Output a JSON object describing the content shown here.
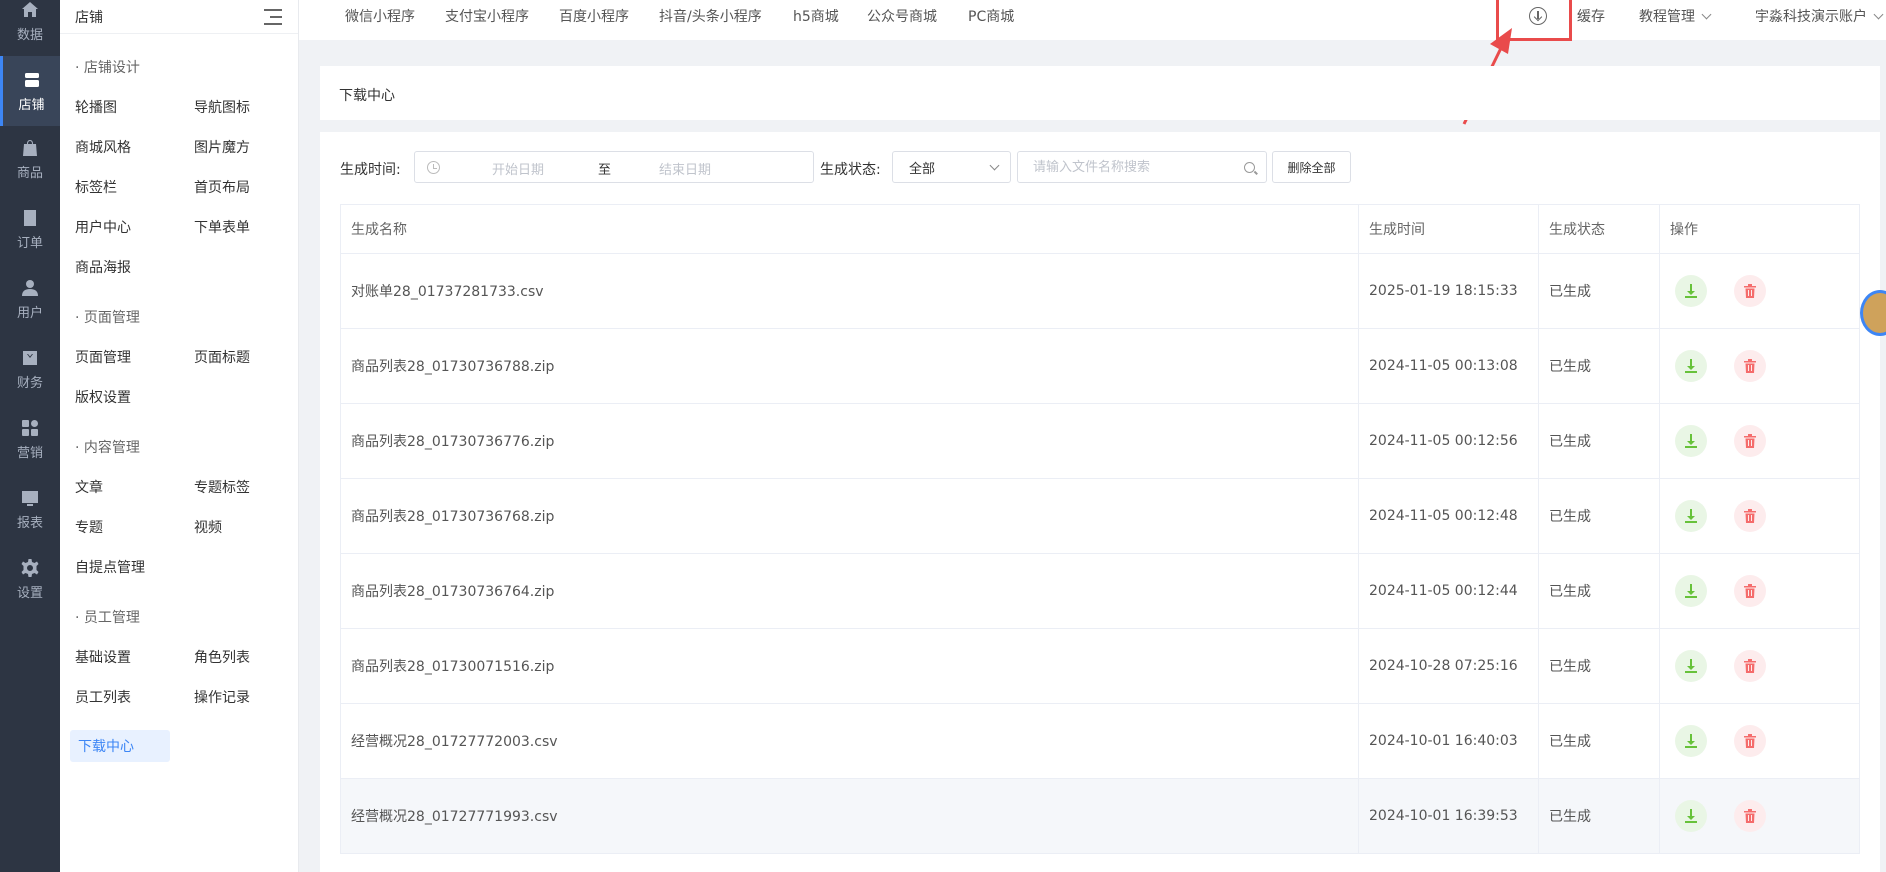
{
  "rail": [
    {
      "label": "数据",
      "icon": "home-icon"
    },
    {
      "label": "店铺",
      "icon": "store-icon",
      "active": true
    },
    {
      "label": "商品",
      "icon": "bag-icon"
    },
    {
      "label": "订单",
      "icon": "order-icon"
    },
    {
      "label": "用户",
      "icon": "user-icon"
    },
    {
      "label": "财务",
      "icon": "finance-icon"
    },
    {
      "label": "营销",
      "icon": "grid-icon"
    },
    {
      "label": "报表",
      "icon": "chart-icon"
    },
    {
      "label": "设置",
      "icon": "gear-icon"
    }
  ],
  "sidebar": {
    "title": "店铺",
    "groups": [
      {
        "title": "· 店铺设计",
        "items": [
          "轮播图",
          "导航图标",
          "商城风格",
          "图片魔方",
          "标签栏",
          "首页布局",
          "用户中心",
          "下单表单",
          "商品海报"
        ]
      },
      {
        "title": "· 页面管理",
        "items": [
          "页面管理",
          "页面标题",
          "版权设置"
        ]
      },
      {
        "title": "· 内容管理",
        "items": [
          "文章",
          "专题标签",
          "专题",
          "视频",
          "自提点管理"
        ]
      },
      {
        "title": "· 员工管理",
        "items": [
          "基础设置",
          "角色列表",
          "员工列表",
          "操作记录"
        ]
      }
    ],
    "active_item": "下载中心"
  },
  "topnav": [
    "微信小程序",
    "支付宝小程序",
    "百度小程序",
    "抖音/头条小程序",
    "h5商城",
    "公众号商城",
    "PC商城"
  ],
  "top_right": {
    "cache": "缓存",
    "tutorial": "教程管理",
    "account": "宇淼科技演示账户"
  },
  "page_title": "下载中心",
  "filters": {
    "time_label": "生成时间:",
    "start_placeholder": "开始日期",
    "range_sep": "至",
    "end_placeholder": "结束日期",
    "status_label": "生成状态:",
    "status_value": "全部",
    "search_placeholder": "请输入文件名称搜索",
    "delete_all": "删除全部"
  },
  "table": {
    "headers": [
      "生成名称",
      "生成时间",
      "生成状态",
      "操作"
    ],
    "rows": [
      {
        "name": "对账单28_01737281733.csv",
        "time": "2025-01-19 18:15:33",
        "status": "已生成"
      },
      {
        "name": "商品列表28_01730736788.zip",
        "time": "2024-11-05 00:13:08",
        "status": "已生成"
      },
      {
        "name": "商品列表28_01730736776.zip",
        "time": "2024-11-05 00:12:56",
        "status": "已生成"
      },
      {
        "name": "商品列表28_01730736768.zip",
        "time": "2024-11-05 00:12:48",
        "status": "已生成"
      },
      {
        "name": "商品列表28_01730736764.zip",
        "time": "2024-11-05 00:12:44",
        "status": "已生成"
      },
      {
        "name": "商品列表28_01730071516.zip",
        "time": "2024-10-28 07:25:16",
        "status": "已生成"
      },
      {
        "name": "经营概况28_01727772003.csv",
        "time": "2024-10-01 16:40:03",
        "status": "已生成"
      },
      {
        "name": "经营概况28_01727771993.csv",
        "time": "2024-10-01 16:39:53",
        "status": "已生成"
      }
    ]
  },
  "colors": {
    "accent": "#3d86f5",
    "rail_bg": "#2d3543",
    "download_green": "#67c23a",
    "delete_red": "#f56c6c",
    "annotation_red": "#e94b4b"
  }
}
